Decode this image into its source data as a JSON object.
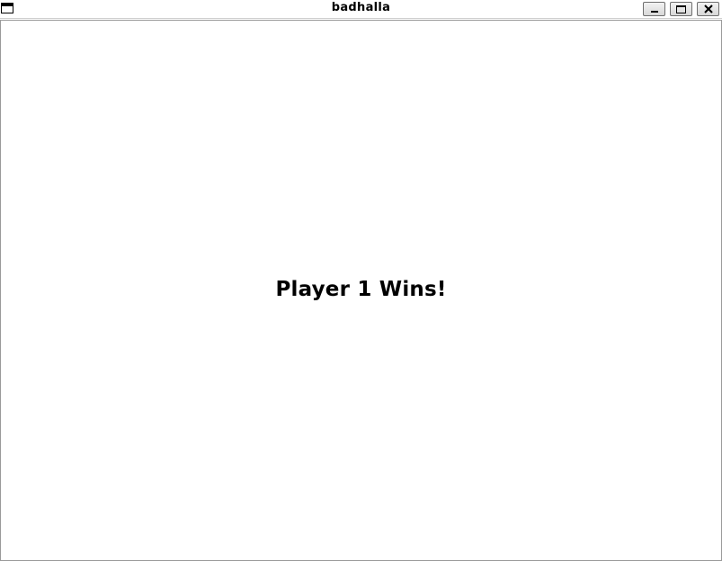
{
  "window": {
    "title": "badhalla"
  },
  "icons": {
    "menu": "window-menu-icon",
    "minimize": "minimize-icon",
    "maximize": "maximize-icon",
    "close": "close-icon"
  },
  "game": {
    "message": "Player 1 Wins!"
  },
  "colors": {
    "background": "#ffffff",
    "text": "#000000"
  }
}
